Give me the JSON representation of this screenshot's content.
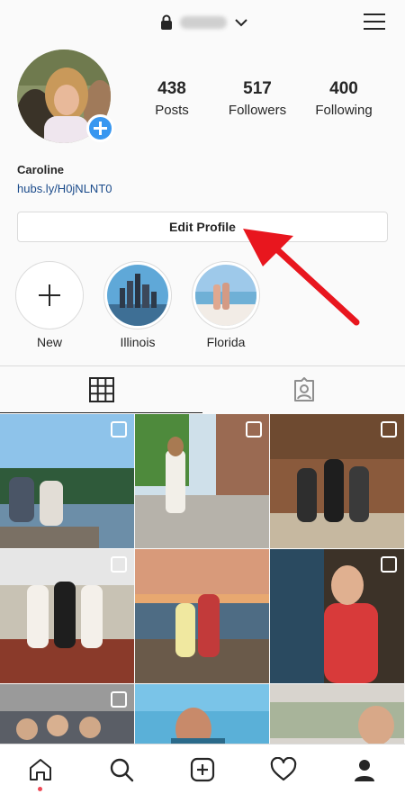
{
  "header": {
    "icons": {
      "lock": "lock-icon",
      "chevron": "chevron-down-icon",
      "menu": "hamburger-menu-icon"
    }
  },
  "profile": {
    "stats": [
      {
        "value": "438",
        "label": "Posts"
      },
      {
        "value": "517",
        "label": "Followers"
      },
      {
        "value": "400",
        "label": "Following"
      }
    ],
    "name": "Caroline",
    "link": "hubs.ly/H0jNLNT0",
    "edit_button": "Edit Profile"
  },
  "highlights": [
    {
      "label": "New",
      "icon": "plus-icon"
    },
    {
      "label": "Illinois"
    },
    {
      "label": "Florida"
    }
  ],
  "tabs": [
    {
      "name": "grid",
      "icon": "grid-icon",
      "active": true
    },
    {
      "name": "tagged",
      "icon": "tagged-person-icon",
      "active": false
    }
  ],
  "bottom_nav": [
    {
      "icon": "home-icon",
      "notification_dot": true
    },
    {
      "icon": "search-icon"
    },
    {
      "icon": "add-post-icon"
    },
    {
      "icon": "heart-icon"
    },
    {
      "icon": "profile-icon"
    }
  ],
  "colors": {
    "accent_blue": "#3897f0",
    "link_blue": "#1a4a8a",
    "arrow_red": "#e8161e",
    "border": "#dbdbdb",
    "notification_dot": "#ed4956"
  }
}
